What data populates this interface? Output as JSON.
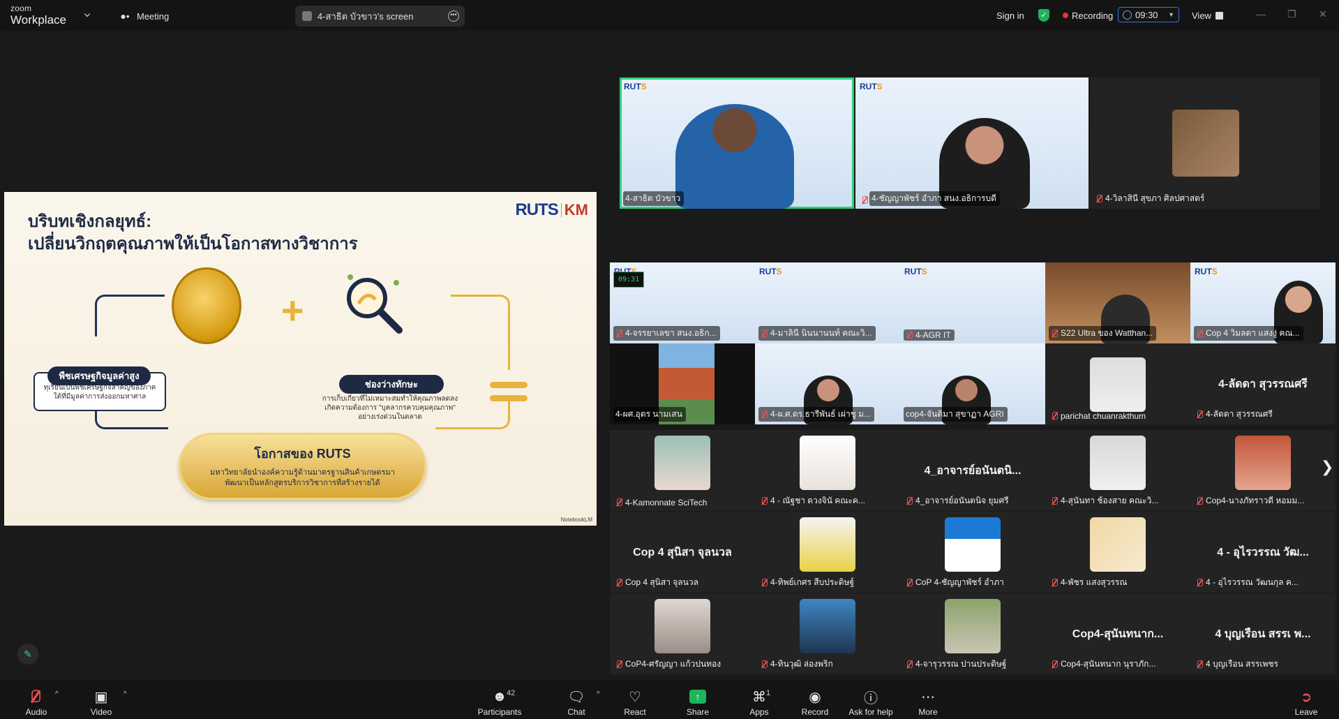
{
  "app": {
    "brand_top": "zoom",
    "brand_bottom": "Workplace"
  },
  "tabs": {
    "meeting": "Meeting",
    "screen": "4-สาธิต บัวขาว's screen"
  },
  "topbar": {
    "signin": "Sign in",
    "recording": "Recording",
    "timer": "09:30",
    "view": "View"
  },
  "colors": {
    "accent": "#2fd07a",
    "recording": "#e53535",
    "mute": "#e55353",
    "timer_border": "#3a72e8"
  },
  "slide": {
    "title_line1": "บริบทเชิงกลยุทธ์:",
    "title_line2": "เปลี่ยนวิกฤตคุณภาพให้เป็นโอกาสทางวิชาการ",
    "logo_ruts": "RUTS",
    "logo_km": "KM",
    "econ_badge": "พืชเศรษฐกิจมูลค่าสูง",
    "econ_text": "ทุเรียนเป็นพืชเศรษฐกิจสำคัญของภาคใต้ที่มีมูลค่าการส่งออกมหาศาล",
    "gap_badge": "ช่องว่างทักษะ",
    "gap_text": "การเก็บเกี่ยวที่ไม่เหมาะสมทำให้คุณภาพลดลง เกิดความต้องการ \"บุคลากรควบคุมคุณภาพ\" อย่างเร่งด่วนในตลาด",
    "opp_title": "โอกาสของ RUTS",
    "opp_text": "มหาวิทยาลัยนำองค์ความรู้ด้านมาตรฐานสินค้าเกษตรมาพัฒนาเป็นหลักสูตรบริการวิชาการที่สร้างรายได้",
    "credit": "NotebookLM"
  },
  "participants": {
    "row0": [
      {
        "name": "4-สาธิต บัวขาว"
      },
      {
        "name": "4-ชัญญาพัชร์ อำภา สนง.อธิการบดี"
      },
      {
        "name": "4-วิลาสินี สุขภา ศิลปศาสตร์"
      }
    ],
    "row1": [
      {
        "name": "4-จรรยาเลขา สนง.อธิก..."
      },
      {
        "name": "4-มาลินี นินนานนท์ คณะวิ..."
      },
      {
        "name": "4-AGR IT"
      },
      {
        "name": "S22 Ultra ของ Watthan..."
      },
      {
        "name": "Cop 4 วิมลดา แสงงู่ คณ..."
      }
    ],
    "row2": [
      {
        "name": "4-ผศ.อุดร นามเสน"
      },
      {
        "name": "4-ผ.ศ.ดร.ธารีพันธ์ เผ่าชู ม..."
      },
      {
        "name": "cop4-จันติมา สุขาฏา AGRI"
      },
      {
        "name": "parichat chuanrakthum"
      },
      {
        "name": "4-ลัดดา สุวรรณศรี",
        "big": "4-ลัดดา สุวรรณศรี"
      }
    ],
    "row3": [
      {
        "name": "4-Kamonnate SciTech"
      },
      {
        "name": "4 - ณัฐชา ดวงจินั คณะค..."
      },
      {
        "name": "4_อาจารย์อนันตนิจ ยุมศรี",
        "big": "4_อาจารย์อนันตนิ..."
      },
      {
        "name": "4-สุนันทา ช้องสาย คณะวิ..."
      },
      {
        "name": "Cop4-นางภัทราวดี หอมม..."
      }
    ],
    "row4": [
      {
        "name": "Cop 4 สุนิสา จุลนวล",
        "big": "Cop 4 สุนิสา จุลนวล"
      },
      {
        "name": "4-ทิพย์เกศร สืบประดิษฐ์"
      },
      {
        "name": "CoP 4-ชัญญาพัชร์ อำภา"
      },
      {
        "name": "4-พัชร แสงสุวรรณ"
      },
      {
        "name": "4 - อุไรวรรณ วัฒนกุล ค...",
        "big": "4 - อุไรวรรณ วัฒ..."
      }
    ],
    "row5": [
      {
        "name": "CoP4-ศรัญญา แก้วปนทอง"
      },
      {
        "name": "4-ทินวุฒิ ล่องพริก"
      },
      {
        "name": "4-จารุวรรณ ปานประดิษฐ์"
      },
      {
        "name": "Cop4-สุนันทนาก นุราภัก...",
        "big": "Cop4-สุนันทนาก..."
      },
      {
        "name": "4 บุญเรือน สรรเพชร",
        "big": "4 บุญเรือน สรรเ พ..."
      }
    ],
    "mini_timer": "09:31"
  },
  "toolbar": {
    "audio": "Audio",
    "video": "Video",
    "participants": "Participants",
    "participants_count": "42",
    "chat": "Chat",
    "react": "React",
    "share": "Share",
    "apps": "Apps",
    "apps_count": "1",
    "record": "Record",
    "help": "Ask for help",
    "more": "More",
    "leave": "Leave"
  }
}
